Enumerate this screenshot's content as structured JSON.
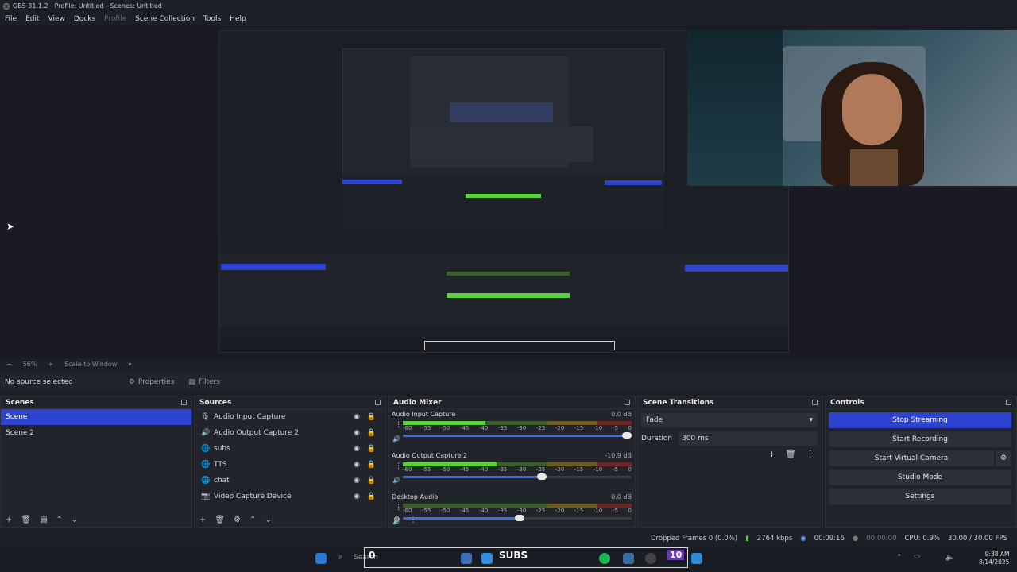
{
  "window": {
    "title": "OBS 31.1.2 - Profile: Untitled - Scenes: Untitled"
  },
  "menu": [
    "File",
    "Edit",
    "View",
    "Docks",
    "Profile",
    "Scene Collection",
    "Tools",
    "Help"
  ],
  "zoom": {
    "level": "56%",
    "mode": "Scale to Window"
  },
  "toolbar": {
    "no_source": "No source selected",
    "properties": "Properties",
    "filters": "Filters"
  },
  "scenes": {
    "title": "Scenes",
    "items": [
      "Scene",
      "Scene 2"
    ]
  },
  "sources": {
    "title": "Sources",
    "items": [
      "Audio Input Capture",
      "Audio Output Capture 2",
      "subs",
      "TTS",
      "chat",
      "Video Capture Device"
    ]
  },
  "mixer": {
    "title": "Audio Mixer",
    "channels": [
      {
        "name": "Audio Input Capture",
        "db": "0.0 dB",
        "level": 0.36,
        "volume": 1.0
      },
      {
        "name": "Audio Output Capture 2",
        "db": "-10.9 dB",
        "level": 0.41,
        "volume": 0.63
      },
      {
        "name": "Desktop Audio",
        "db": "0.0 dB",
        "level": 0.0,
        "volume": 0.53
      }
    ],
    "ticks": [
      "-60",
      "-55",
      "-50",
      "-45",
      "-40",
      "-35",
      "-30",
      "-25",
      "-20",
      "-15",
      "-10",
      "-5",
      "0"
    ]
  },
  "transitions": {
    "title": "Scene Transitions",
    "selected": "Fade",
    "duration_label": "Duration",
    "duration_value": "300 ms"
  },
  "controls": {
    "title": "Controls",
    "stop_streaming": "Stop Streaming",
    "start_recording": "Start Recording",
    "start_virtual_camera": "Start Virtual Camera",
    "studio_mode": "Studio Mode",
    "settings": "Settings"
  },
  "status": {
    "dropped": "Dropped Frames 0 (0.0%)",
    "bitrate": "2764 kbps",
    "stream_time": "00:09:16",
    "rec_time": "00:00:00",
    "cpu": "CPU: 0.9%",
    "fps": "30.00 / 30.00 FPS"
  },
  "taskbar": {
    "search": "Search",
    "overlay_num": "0",
    "overlay_subs": "SUBS",
    "overlay_count": "10",
    "time": "9:38 AM",
    "date": "8/14/2025"
  },
  "colors": {
    "accent": "#2c44d0",
    "meter_green": "#59d23a"
  }
}
